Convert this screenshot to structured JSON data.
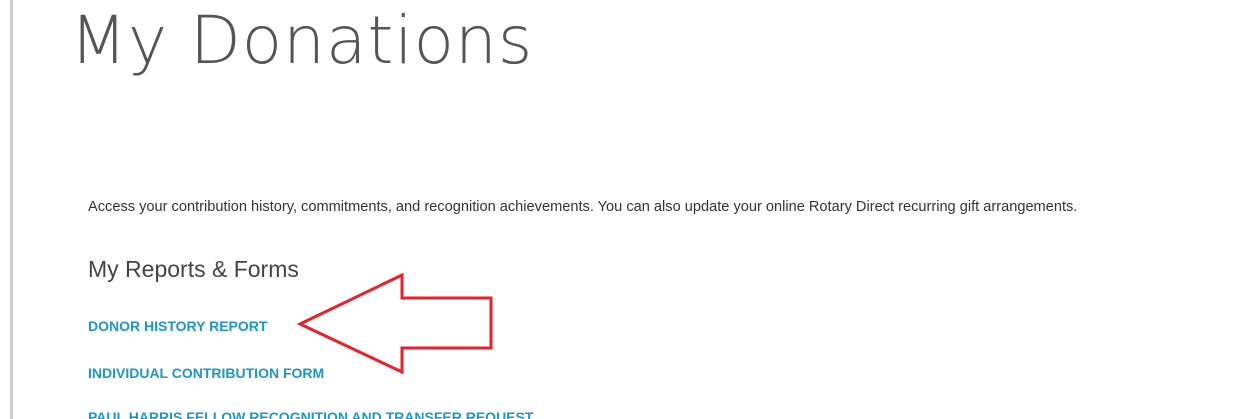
{
  "page": {
    "title": "My Donations",
    "intro": "Access your contribution history, commitments, and recognition achievements. You can also update your online Rotary Direct recurring gift arrangements."
  },
  "reports_section": {
    "heading": "My Reports & Forms",
    "links": [
      {
        "label": "DONOR HISTORY REPORT"
      },
      {
        "label": "INDIVIDUAL CONTRIBUTION FORM"
      },
      {
        "label": "PAUL HARRIS FELLOW RECOGNITION AND TRANSFER REQUEST"
      }
    ]
  },
  "colors": {
    "link": "#1d96c8",
    "title": "#555555",
    "annotation_arrow": "#e8212b"
  }
}
